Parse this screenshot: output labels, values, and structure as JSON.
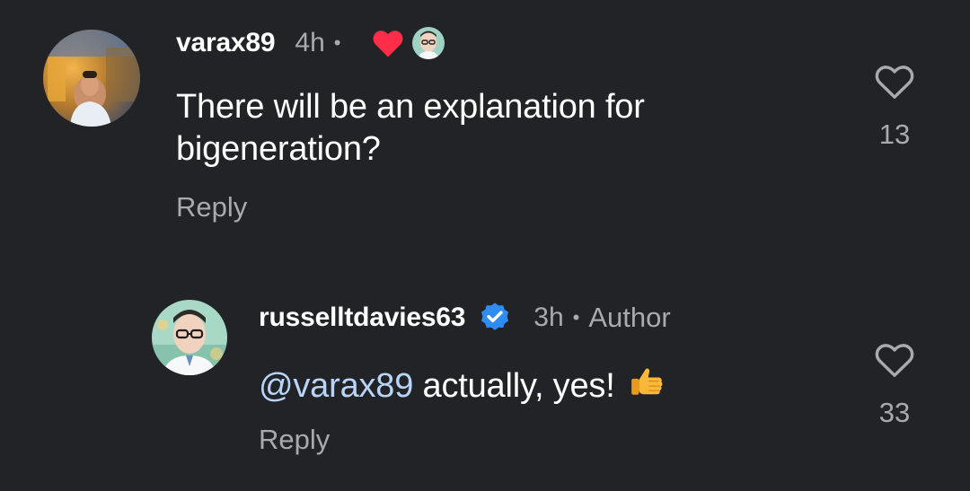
{
  "comments": [
    {
      "username": "varax89",
      "time": "4h",
      "separator": "•",
      "text_line1": "There will be an explanation for",
      "text_line2": "bigeneration?",
      "reply_label": "Reply",
      "like_count": "13",
      "liked_by_author_icon": "heart-icon",
      "avatar_icon": "user-avatar"
    },
    {
      "username": "russelltdavies63",
      "verified_icon": "verified-badge-icon",
      "time": "3h",
      "separator": "•",
      "author_label": "Author",
      "mention": "@varax89",
      "text": " actually, yes!",
      "emoji": "👍",
      "reply_label": "Reply",
      "like_count": "33",
      "avatar_icon": "user-avatar"
    }
  ],
  "colors": {
    "background": "#222326",
    "secondary_text": "#a8aab0",
    "mention": "#b8d4f7",
    "heart": "#ff2d47",
    "verified": "#2f8cf2"
  }
}
